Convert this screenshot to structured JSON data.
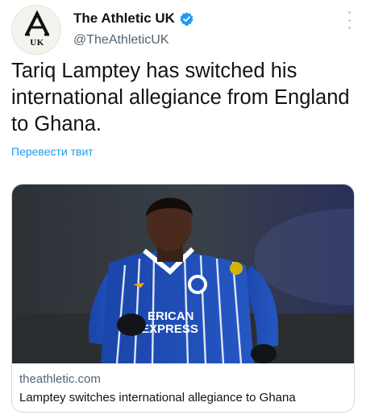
{
  "account": {
    "display_name": "The Athletic UK",
    "handle": "@TheAthleticUK",
    "avatar_text": "UK",
    "verified": true
  },
  "tweet": {
    "text": "Tariq Lamptey has switched his international allegiance from England to Ghana.",
    "translate_label": "Перевести твит"
  },
  "card": {
    "domain": "theathletic.com",
    "title": "Lamptey switches international allegiance to Ghana",
    "image_description_icon": "player-photo",
    "shirt_text": "ERICAN EXPRESS"
  },
  "colors": {
    "link_blue": "#1d9bf0",
    "verified_blue": "#1d9bf0",
    "secondary_text": "#536471",
    "kit_blue": "#1f4fb8"
  }
}
